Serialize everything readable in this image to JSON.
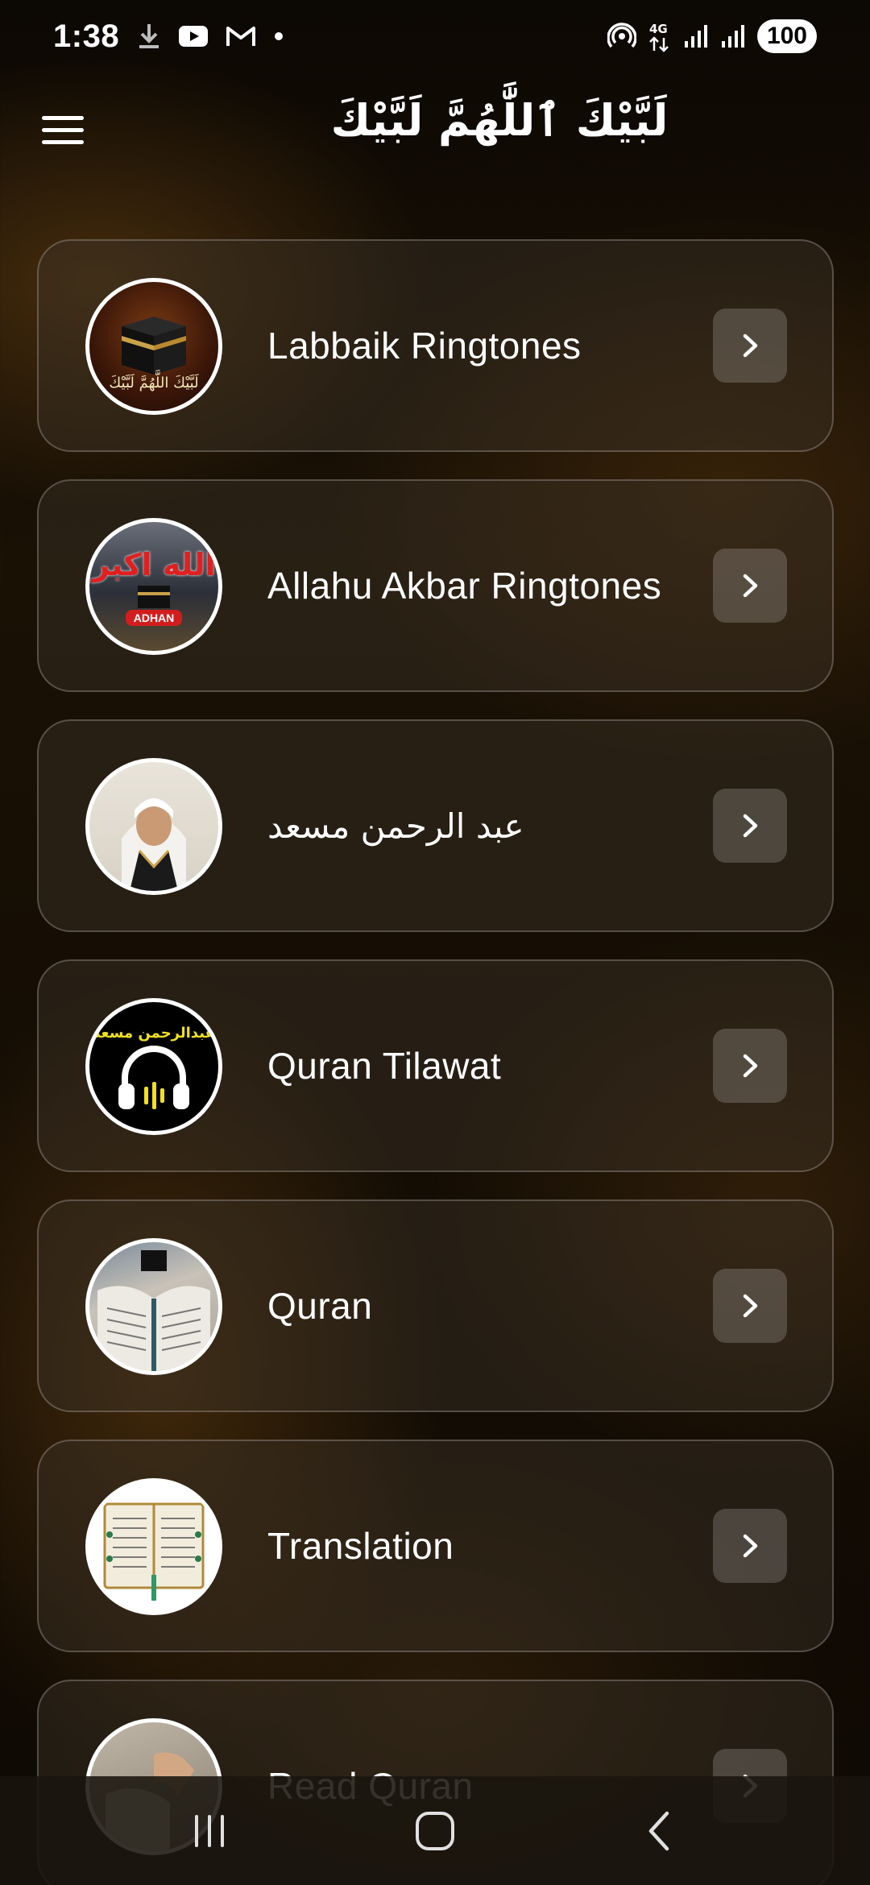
{
  "status_bar": {
    "time": "1:38",
    "battery": "100",
    "network": "4G",
    "left_icons": [
      "download-icon",
      "youtube-icon",
      "gmail-icon",
      "dot-icon"
    ],
    "right_icons": [
      "hotspot-icon",
      "4g-data-icon",
      "signal-icon",
      "signal-icon-2"
    ]
  },
  "app_bar": {
    "title": "لَبَّيْكَ ٱللَّٰهُمَّ لَبَّيْكَ",
    "menu_icon": "hamburger-menu-icon"
  },
  "menu_items": [
    {
      "label": "Labbaik Ringtones",
      "thumb_text": "لَبَّيْكَ اللَّهُمَّ لَبَّيْكَ",
      "icon": "kaaba-thumbnail"
    },
    {
      "label": "Allahu Akbar Ringtones",
      "thumb_text": "الله اكبر",
      "thumb_badge": "ADHAN",
      "icon": "allahu-akbar-thumbnail"
    },
    {
      "label": "عبد الرحمن مسعد",
      "icon": "reciter-portrait-thumbnail"
    },
    {
      "label": "Quran Tilawat",
      "thumb_text": "عبدالرحمن مسعد",
      "icon": "headphones-thumbnail"
    },
    {
      "label": "Quran",
      "icon": "open-quran-thumbnail"
    },
    {
      "label": "Translation",
      "icon": "quran-book-thumbnail"
    },
    {
      "label": "Read Quran",
      "icon": "reading-quran-thumbnail"
    }
  ],
  "nav_bar": {
    "icons": [
      "recent-apps-icon",
      "home-icon",
      "back-icon"
    ]
  },
  "colors": {
    "background": "#140d04",
    "card_fill": "#3c3228",
    "accent_gold": "#c9a14a",
    "text": "#ffffff"
  }
}
